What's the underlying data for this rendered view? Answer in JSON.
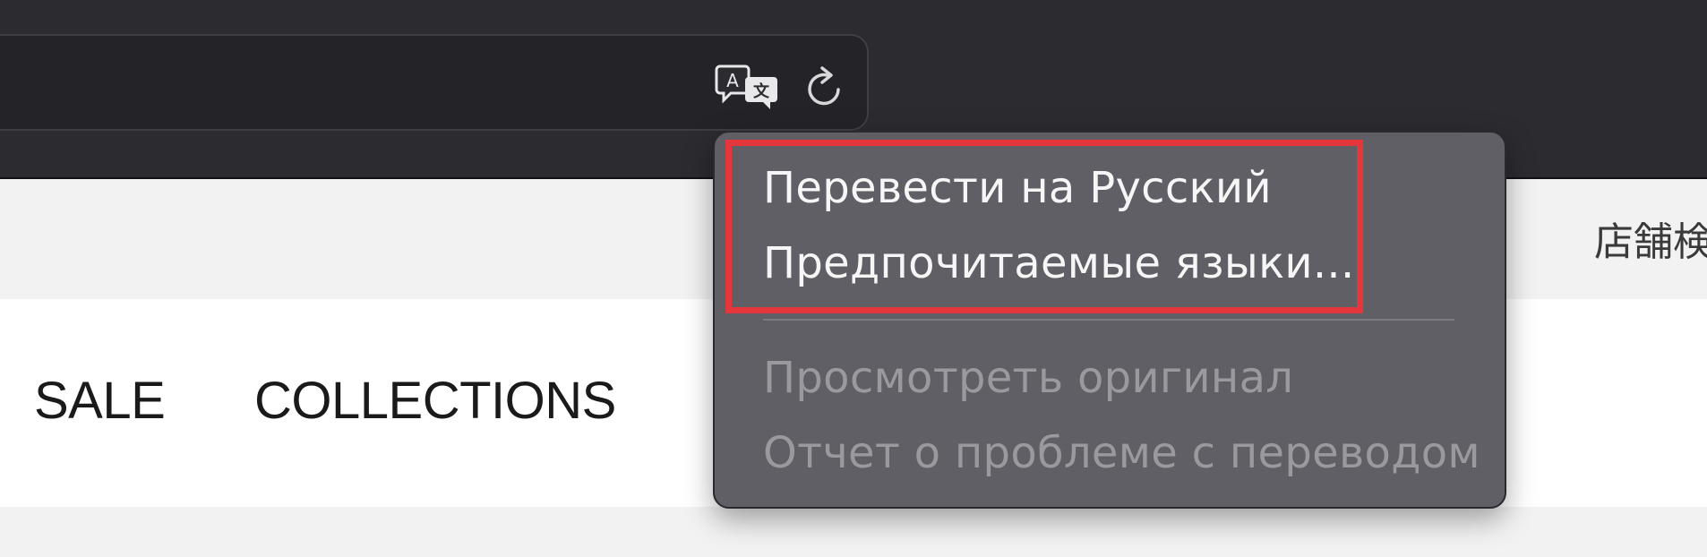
{
  "toolbar": {
    "translate_icon": "translate-icon",
    "reload_icon": "reload-icon"
  },
  "page": {
    "store_search_label": "店舗検",
    "nav": {
      "items": [
        "SALE",
        "COLLECTIONS"
      ]
    }
  },
  "translate_menu": {
    "items": [
      {
        "label": "Перевести на Русский",
        "enabled": true
      },
      {
        "label": "Предпочитаемые языки...",
        "enabled": true
      },
      {
        "label": "Просмотреть оригинал",
        "enabled": false
      },
      {
        "label": "Отчет о проблеме с переводом",
        "enabled": false
      }
    ],
    "highlight_color": "#e5373b"
  },
  "colors": {
    "toolbar_bg": "#2c2b30",
    "menu_bg": "#605f65",
    "page_bg": "#f2f2f2"
  }
}
